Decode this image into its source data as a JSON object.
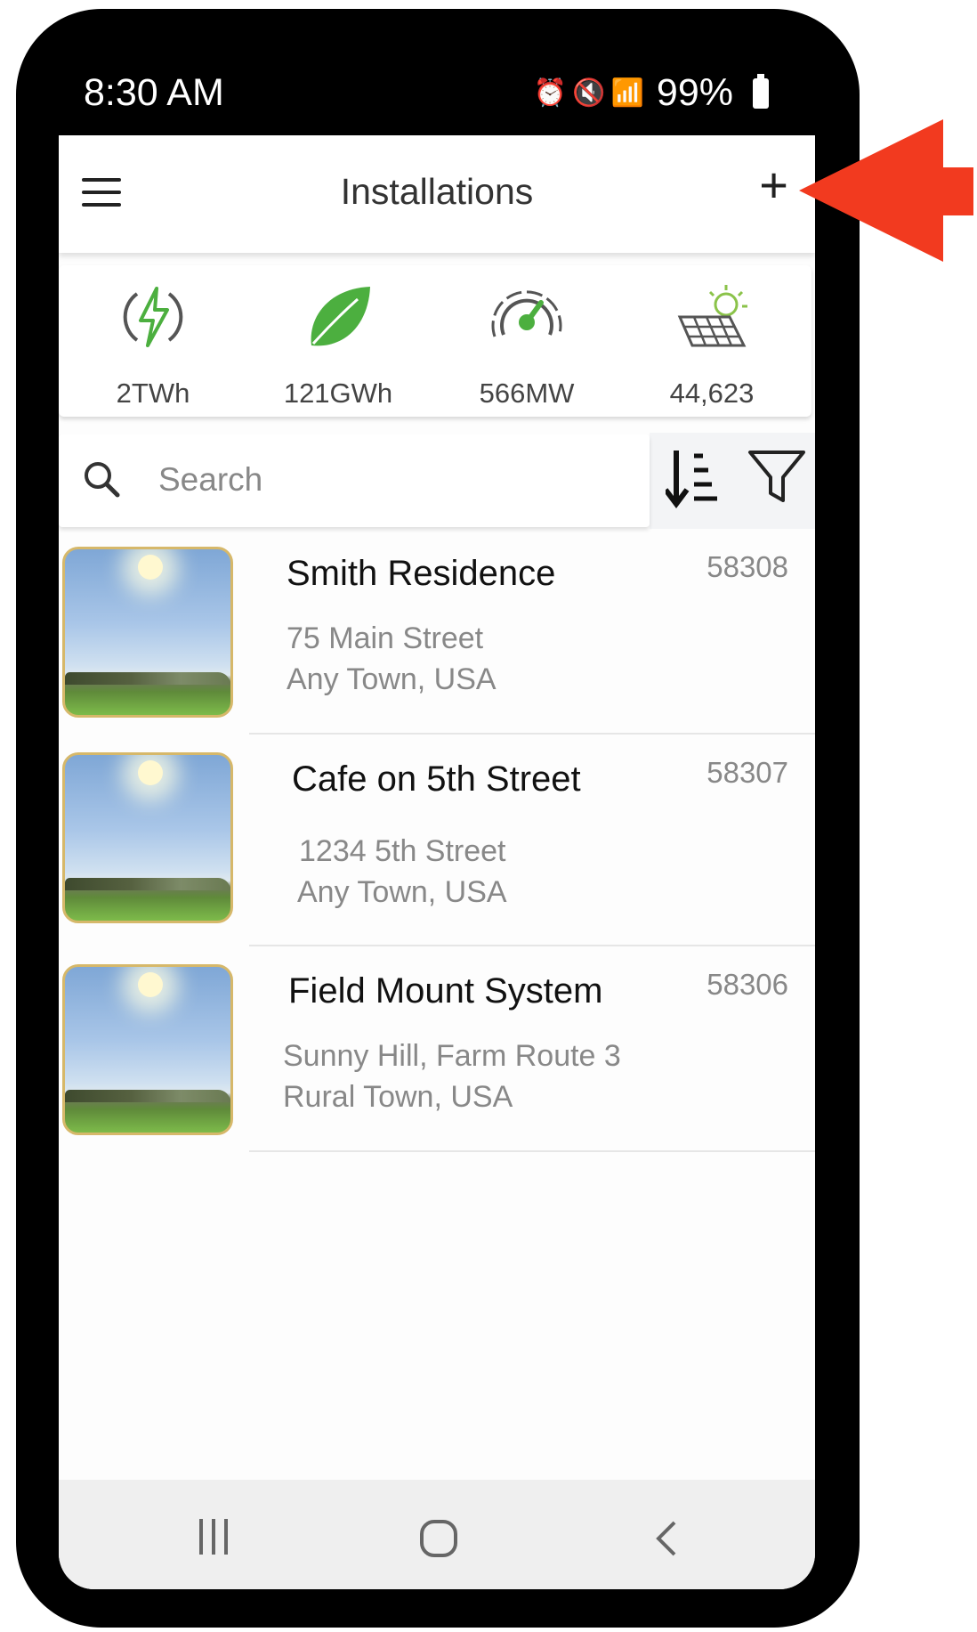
{
  "status_bar": {
    "time": "8:30 AM",
    "battery": "99%"
  },
  "header": {
    "title": "Installations",
    "add_label": "+"
  },
  "stats": [
    {
      "icon": "energy-bolt-icon",
      "value": "2TWh"
    },
    {
      "icon": "leaf-icon",
      "value": "121GWh"
    },
    {
      "icon": "gauge-icon",
      "value": "566MW"
    },
    {
      "icon": "solar-panel-icon",
      "value": "44,623"
    }
  ],
  "search": {
    "placeholder": "Search"
  },
  "installations": [
    {
      "name": "Smith Residence",
      "id": "58308",
      "address_line1": "75 Main Street",
      "address_line2": "Any Town, USA"
    },
    {
      "name": "Cafe on 5th Street",
      "id": "58307",
      "address_line1": "1234 5th Street",
      "address_line2": "Any Town, USA"
    },
    {
      "name": "Field Mount System",
      "id": "58306",
      "address_line1": "Sunny Hill, Farm Route 3",
      "address_line2": "Rural Town, USA"
    }
  ],
  "colors": {
    "accent_green": "#4caf3f",
    "arrow_red": "#f23a1f",
    "thumb_border": "#d6b86a"
  }
}
